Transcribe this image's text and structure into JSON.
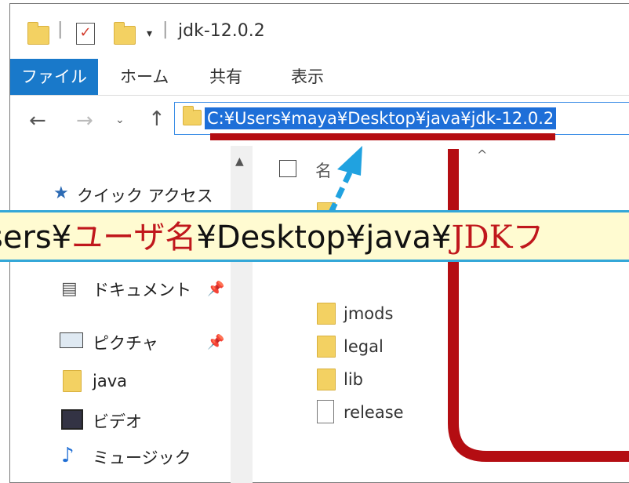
{
  "window": {
    "title": "jdk-12.0.2"
  },
  "ribbon": {
    "tabs": [
      "ファイル",
      "ホーム",
      "共有",
      "表示"
    ]
  },
  "address": {
    "path": "C:¥Users¥maya¥Desktop¥java¥jdk-12.0.2"
  },
  "nav": {
    "items": [
      {
        "label": "クイック アクセス",
        "icon": "star-icon"
      },
      {
        "label": "ドキュメント",
        "icon": "document-icon",
        "pinned": true
      },
      {
        "label": "ピクチャ",
        "icon": "picture-icon",
        "pinned": true
      },
      {
        "label": "java",
        "icon": "folder-icon"
      },
      {
        "label": "ビデオ",
        "icon": "video-icon"
      },
      {
        "label": "ミュージック",
        "icon": "music-note-icon"
      }
    ]
  },
  "files": {
    "name_header": "名",
    "rows": [
      {
        "name": "jmods",
        "type": "folder"
      },
      {
        "name": "legal",
        "type": "folder"
      },
      {
        "name": "lib",
        "type": "folder"
      },
      {
        "name": "release",
        "type": "file"
      }
    ]
  },
  "annotation": {
    "prefix": "sers¥",
    "user_part": "ユーザ名",
    "middle": "¥Desktop¥java¥",
    "jdk_part": "JDKフ"
  },
  "colors": {
    "highlight_red": "#b40d12",
    "banner_bg": "#fffbd1",
    "banner_border": "#34a7d8",
    "ribbon_file": "#1979ca",
    "address_selection": "#1e6fd8"
  }
}
